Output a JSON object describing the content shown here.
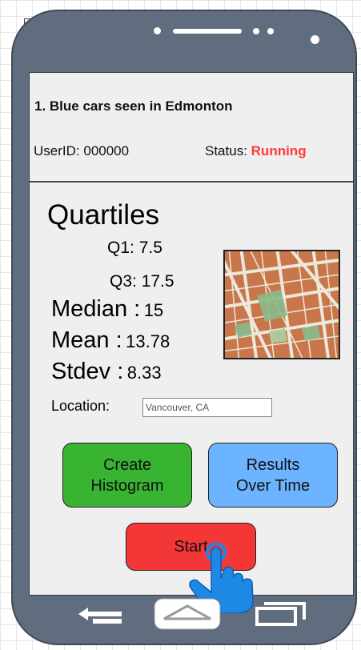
{
  "task": {
    "title": "1. Blue cars seen in Edmonton",
    "userid_label": "UserID:",
    "userid_value": "000000",
    "status_label": "Status:",
    "status_value": "Running"
  },
  "stats": {
    "section_title": "Quartiles",
    "q1_label": "Q1:",
    "q1_value": "7.5",
    "q3_label": "Q3:",
    "q3_value": "17.5",
    "median_label": "Median :",
    "median_value": "15",
    "mean_label": "Mean :",
    "mean_value": "13.78",
    "stdev_label": "Stdev :",
    "stdev_value": "8.33"
  },
  "location": {
    "label": "Location:",
    "value": "Vancouver, CA"
  },
  "buttons": {
    "histogram_line1": "Create",
    "histogram_line2": "Histogram",
    "results_line1": "Results",
    "results_line2": "Over Time",
    "start": "Start"
  },
  "colors": {
    "status_running": "#ff3b3b",
    "histogram_button": "#38b332",
    "results_button": "#6cb4ff",
    "start_button": "#f33636",
    "phone_body": "#5f6d7e",
    "hand_cursor": "#1e88e5"
  },
  "icons": {
    "map": "map-thumbnail",
    "pointer": "hand-pointer-icon",
    "back": "back-arrow-icon",
    "home": "home-icon",
    "recent": "recent-apps-icon"
  }
}
